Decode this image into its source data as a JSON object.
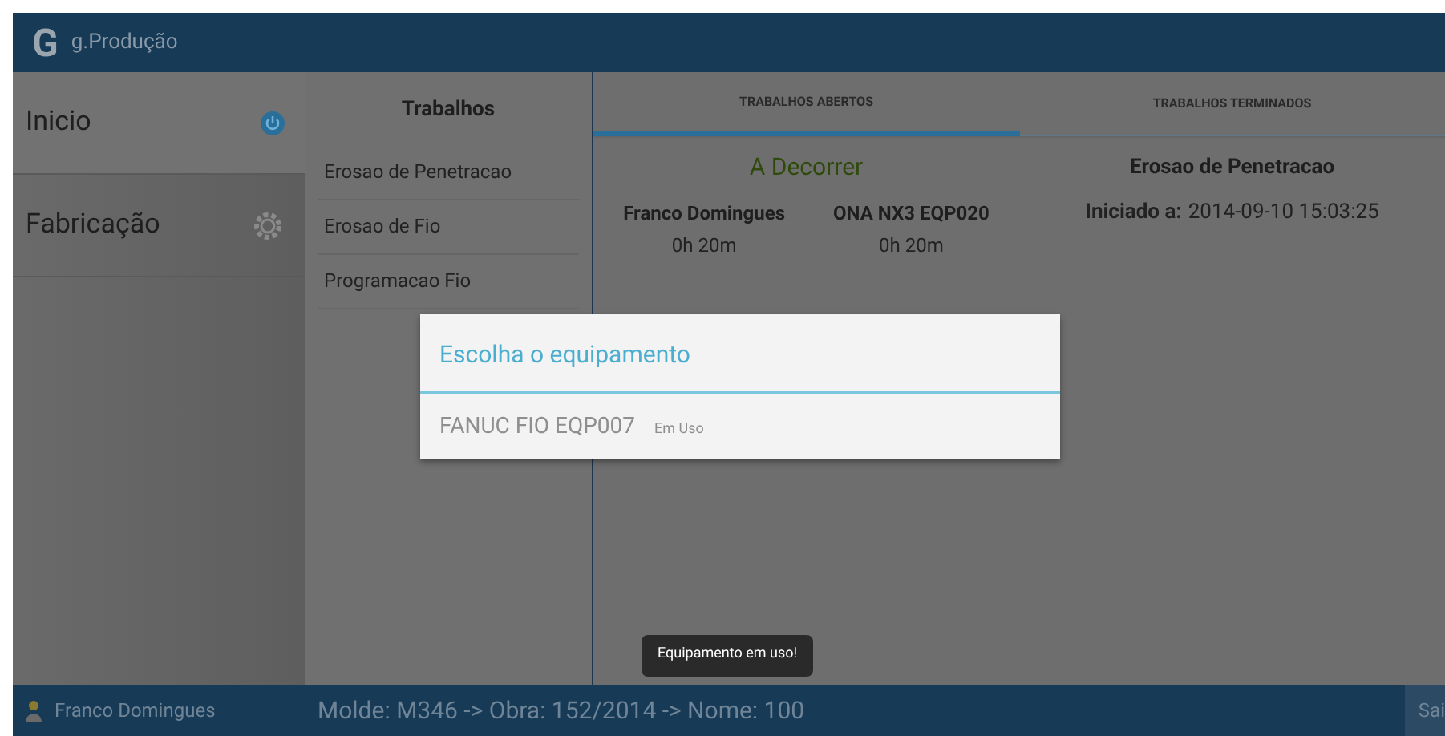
{
  "app": {
    "logo": "G",
    "title": "g.Produção"
  },
  "sidebar": {
    "items": [
      {
        "label": "Inicio",
        "kind": "power",
        "selected": true
      },
      {
        "label": "Fabricação",
        "kind": "gear",
        "selected": false
      }
    ]
  },
  "jobs": {
    "title": "Trabalhos",
    "items": [
      "Erosao de Penetracao",
      "Erosao de Fio",
      "Programacao Fio"
    ]
  },
  "tabs": [
    {
      "label": "TRABALHOS ABERTOS",
      "selected": true
    },
    {
      "label": "TRABALHOS TERMINADOS",
      "selected": false
    }
  ],
  "running": {
    "status": "A Decorrer",
    "columns": [
      {
        "name": "Franco Domingues",
        "time": "0h 20m"
      },
      {
        "name": "ONA NX3 EQP020",
        "time": "0h 20m"
      }
    ]
  },
  "detail": {
    "title": "Erosao de Penetracao",
    "started_label": "Iniciado a:",
    "started_value": "2014-09-10 15:03:25"
  },
  "dialog": {
    "title": "Escolha o equipamento",
    "options": [
      {
        "name": "FANUC FIO EQP007",
        "note": "Em Uso",
        "disabled": true
      }
    ]
  },
  "toast": "Equipamento em uso!",
  "status_bar": {
    "user": "Franco Domingues",
    "info": "Molde: M346 -> Obra: 152/2014 -> Nome: 100",
    "button": "Sai"
  }
}
